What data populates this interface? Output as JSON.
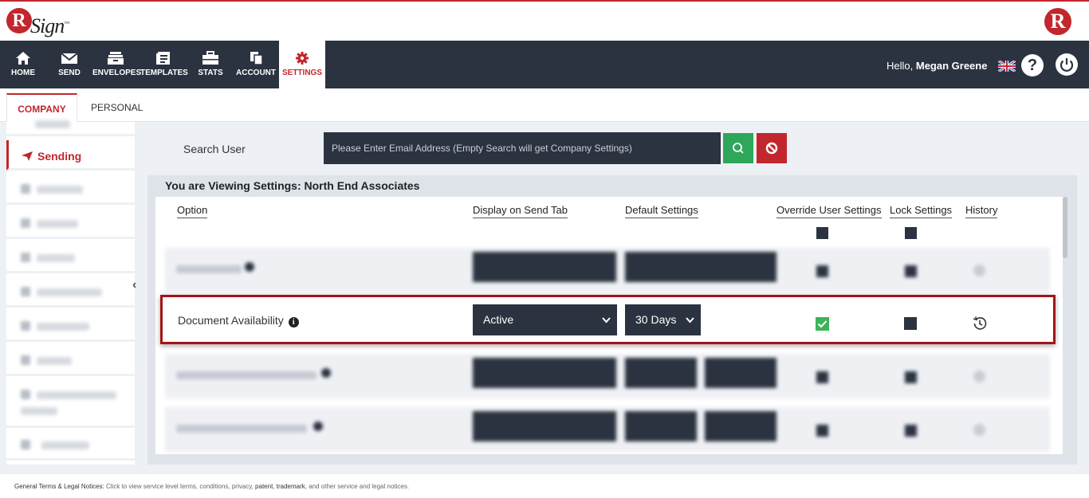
{
  "brand": {
    "logo_letter": "R",
    "logo_script": "Sign",
    "logo_tm": "™",
    "right_logo_letter": "R"
  },
  "nav": {
    "items": [
      {
        "label": "HOME",
        "icon": "home-icon"
      },
      {
        "label": "SEND",
        "icon": "envelope-icon"
      },
      {
        "label": "ENVELOPES",
        "icon": "inbox-icon"
      },
      {
        "label": "TEMPLATES",
        "icon": "document-icon"
      },
      {
        "label": "STATS",
        "icon": "briefcase-icon"
      },
      {
        "label": "ACCOUNT",
        "icon": "copy-icon"
      },
      {
        "label": "SETTINGS",
        "icon": "gear-icon"
      }
    ],
    "active": "SETTINGS",
    "greeting": "Hello,",
    "user_name": "Megan Greene",
    "help_glyph": "?"
  },
  "tabs": {
    "company": "COMPANY",
    "personal": "PERSONAL",
    "active": "COMPANY"
  },
  "sidebar": {
    "active_label": "Sending",
    "active_icon": "paper-plane-icon"
  },
  "search": {
    "label": "Search User",
    "placeholder": "Please Enter Email Address (Empty Search will get Company Settings)"
  },
  "settings": {
    "viewing": "You are Viewing Settings: North End Associates",
    "columns": {
      "option": "Option",
      "display": "Display on Send Tab",
      "default": "Default Settings",
      "override": "Override User Settings",
      "lock": "Lock Settings",
      "history": "History"
    },
    "focused_row": {
      "option": "Document Availability",
      "info_glyph": "i",
      "display_value": "Active",
      "default_value": "30 Days",
      "override_checked": true,
      "lock_checked": false
    }
  },
  "footer": {
    "title": "General Terms & Legal Notices:",
    "text1": " Click to view service level terms, conditions, privacy, ",
    "patent": "patent",
    "sep": ", ",
    "trademark": "trademark",
    "text2": ", and other service and legal notices."
  },
  "colors": {
    "accent": "#c1272d",
    "nav_bg": "#2b3340",
    "success": "#2ea75b"
  }
}
